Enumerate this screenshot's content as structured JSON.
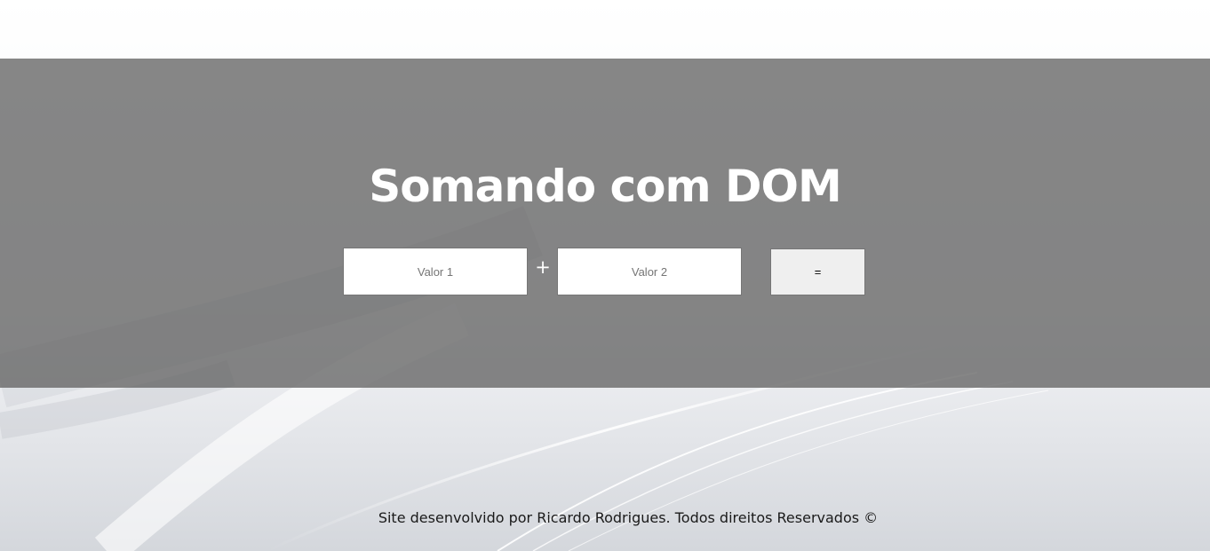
{
  "page": {
    "title": "Somando com DOM",
    "footer": "Site desenvolvido por Ricardo Rodrigues. Todos direitos Reservados ©"
  },
  "form": {
    "input1": {
      "value": "",
      "placeholder": "Valor 1"
    },
    "input2": {
      "value": "",
      "placeholder": "Valor 2"
    },
    "operator": "+",
    "submit_label": "="
  },
  "colors": {
    "hero_overlay": "#808080",
    "title_text": "#ffffff",
    "button_bg": "#efefef",
    "input_bg": "#ffffff"
  }
}
